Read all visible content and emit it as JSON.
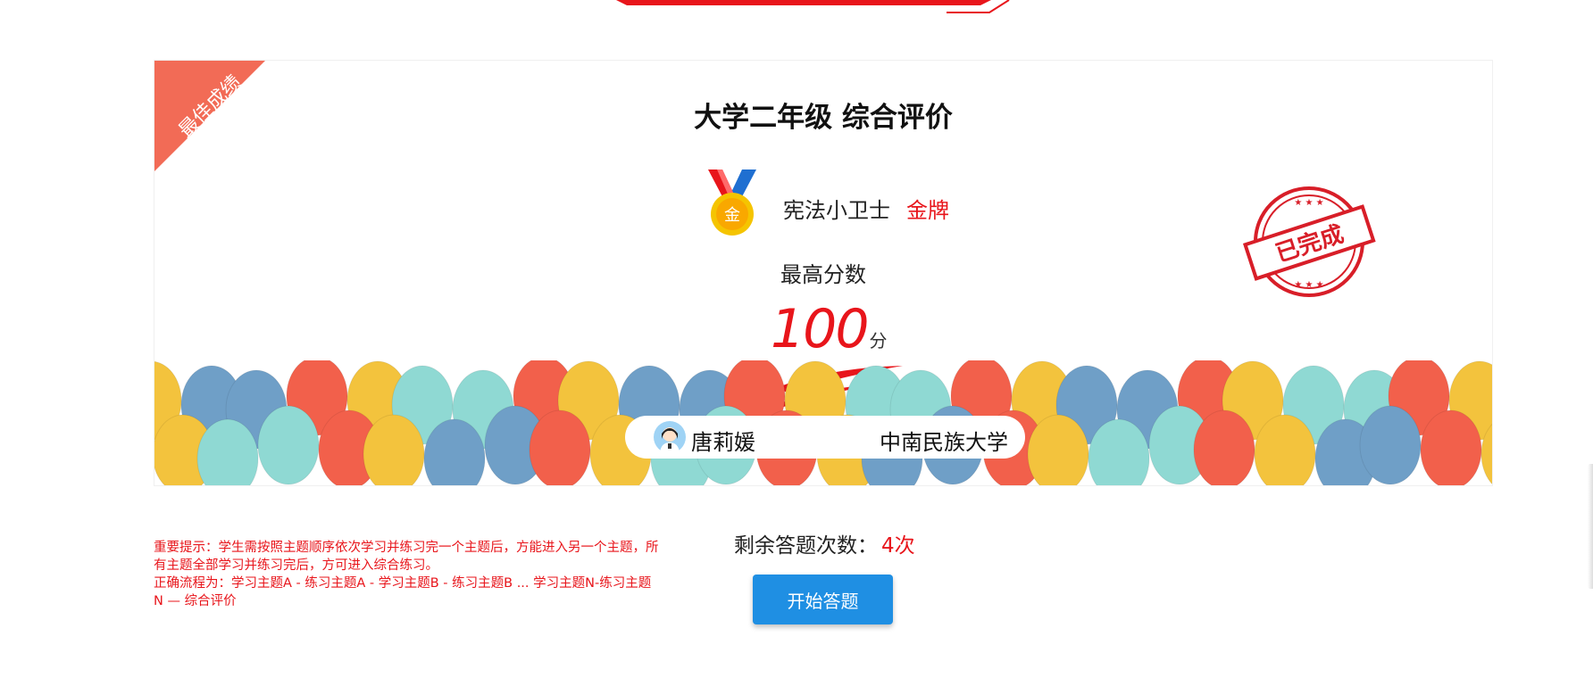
{
  "card": {
    "ribbon_label": "最佳成绩",
    "title": "大学二年级 综合评价",
    "medal_name": "宪法小卫士",
    "medal_level": "金牌",
    "medal_glyph": "金",
    "best_label": "最高分数",
    "score": "100",
    "score_unit": "分",
    "stamp_text": "已完成",
    "user_name": "唐莉媛",
    "school": "中南民族大学"
  },
  "notice": {
    "line1": "重要提示：学生需按照主题顺序依次学习并练习完一个主题后，方能进入另一个主题，所有主题全部学习并练习完后，方可进入综合练习。",
    "line2": "正确流程为：学习主题A - 练习主题A - 学习主题B - 练习主题B ... 学习主题N-练习主题N — 综合评价"
  },
  "attempts": {
    "label": "剩余答题次数：",
    "value": "4次"
  },
  "start_button": "开始答题",
  "colors": {
    "accent_red": "#e8151b",
    "button_blue": "#1f8fe3",
    "ribbon_coral": "#f26b56"
  }
}
